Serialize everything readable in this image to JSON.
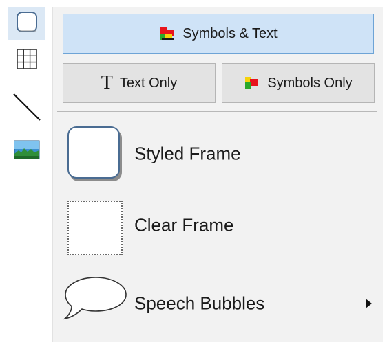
{
  "toolbar": {
    "tools": [
      {
        "name": "frame-tool",
        "icon": "rounded-square-icon",
        "selected": true
      },
      {
        "name": "table-tool",
        "icon": "grid-icon",
        "selected": false
      },
      {
        "name": "line-tool",
        "icon": "diagonal-line-icon",
        "selected": false
      },
      {
        "name": "image-tool",
        "icon": "landscape-image-icon",
        "selected": false
      }
    ]
  },
  "modes": {
    "symbols_and_text": "Symbols & Text",
    "text_only": "Text Only",
    "symbols_only": "Symbols Only",
    "active": "symbols_and_text"
  },
  "items": {
    "styled_frame": "Styled Frame",
    "clear_frame": "Clear Frame",
    "speech_bubbles": "Speech Bubbles"
  },
  "colors": {
    "active_button_bg": "#cfe3f7",
    "active_button_border": "#6ea4d6",
    "frame_border": "#4a6c92",
    "symbol_red": "#e8141c",
    "symbol_green": "#2aa82a",
    "symbol_yellow": "#f5d20a"
  },
  "icons": {
    "text_glyph": "T",
    "submenu": "triangle-right-icon"
  }
}
